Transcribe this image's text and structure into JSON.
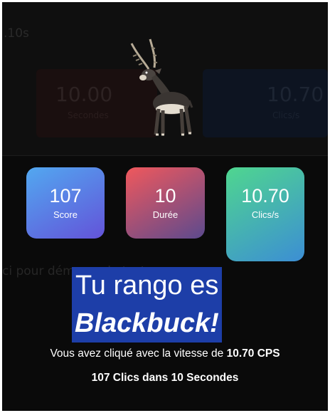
{
  "background": {
    "hint": ".10s",
    "left_card": {
      "value": "10.00",
      "label": "Secondes"
    },
    "right_card": {
      "value": "10.70",
      "label": "Clics/s"
    },
    "cta": "ci pour démarrer le test"
  },
  "stats": {
    "score": {
      "value": "107",
      "label": "Score"
    },
    "duree": {
      "value": "10",
      "label": "Durée"
    },
    "cps": {
      "value": "10.70",
      "label": "Clics/s"
    }
  },
  "result": {
    "headline_line1": "Tu rango es",
    "headline_line2": "Blackbuck!",
    "animal_icon": "blackbuck-antelope",
    "speed_prefix": "Vous avez cliqué avec la vitesse de",
    "speed_value": "10.70 CPS",
    "summary": "107 Clics dans 10 Secondes"
  },
  "colors": {
    "headline_bg": "#1d3ea8",
    "score_gradient": [
      "#52a8f0",
      "#6353d9"
    ],
    "duree_gradient": [
      "#f0585c",
      "#5c4a8e"
    ],
    "cps_gradient": [
      "#4fd68f",
      "#3c8ed4"
    ]
  }
}
